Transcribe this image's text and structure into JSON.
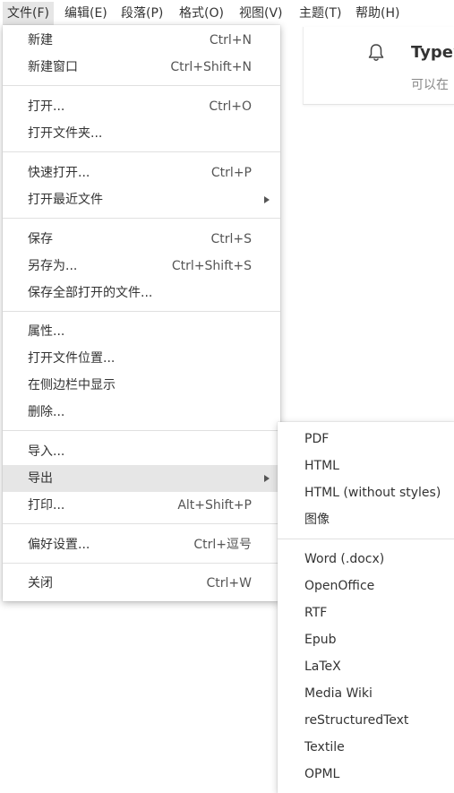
{
  "menubar": {
    "items": [
      {
        "label": "文件(F)"
      },
      {
        "label": "编辑(E)"
      },
      {
        "label": "段落(P)"
      },
      {
        "label": "格式(O)"
      },
      {
        "label": "视图(V)"
      },
      {
        "label": "主题(T)"
      },
      {
        "label": "帮助(H)"
      }
    ]
  },
  "notification": {
    "icon": "bell-icon",
    "title": "Typew",
    "subtitle": "可以在"
  },
  "file_menu": {
    "items": [
      {
        "label": "新建",
        "shortcut": "Ctrl+N"
      },
      {
        "label": "新建窗口",
        "shortcut": "Ctrl+Shift+N"
      },
      {
        "label": "打开...",
        "shortcut": "Ctrl+O"
      },
      {
        "label": "打开文件夹...",
        "shortcut": ""
      },
      {
        "label": "快速打开...",
        "shortcut": "Ctrl+P"
      },
      {
        "label": "打开最近文件",
        "shortcut": "",
        "submenu_arrow": true
      },
      {
        "label": "保存",
        "shortcut": "Ctrl+S"
      },
      {
        "label": "另存为...",
        "shortcut": "Ctrl+Shift+S"
      },
      {
        "label": "保存全部打开的文件...",
        "shortcut": ""
      },
      {
        "label": "属性...",
        "shortcut": ""
      },
      {
        "label": "打开文件位置...",
        "shortcut": ""
      },
      {
        "label": "在侧边栏中显示",
        "shortcut": ""
      },
      {
        "label": "删除...",
        "shortcut": ""
      },
      {
        "label": "导入...",
        "shortcut": ""
      },
      {
        "label": "导出",
        "shortcut": "",
        "submenu_arrow": true,
        "highlighted": true
      },
      {
        "label": "打印...",
        "shortcut": "Alt+Shift+P"
      },
      {
        "label": "偏好设置...",
        "shortcut": "Ctrl+逗号"
      },
      {
        "label": "关闭",
        "shortcut": "Ctrl+W"
      }
    ]
  },
  "export_submenu": {
    "items": [
      {
        "label": "PDF"
      },
      {
        "label": "HTML"
      },
      {
        "label": "HTML (without styles)"
      },
      {
        "label": "图像"
      },
      {
        "label": "Word (.docx)"
      },
      {
        "label": "OpenOffice"
      },
      {
        "label": "RTF"
      },
      {
        "label": "Epub"
      },
      {
        "label": "LaTeX"
      },
      {
        "label": "Media Wiki"
      },
      {
        "label": "reStructuredText"
      },
      {
        "label": "Textile"
      },
      {
        "label": "OPML"
      }
    ]
  },
  "colors": {
    "highlight": "#e6e6e6",
    "text": "#333333",
    "separator": "#e0e0e0"
  }
}
